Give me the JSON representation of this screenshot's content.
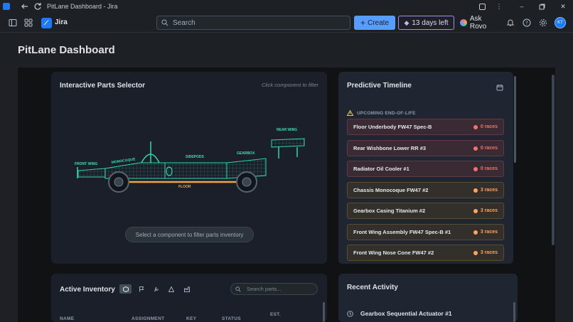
{
  "window": {
    "title": "PitLane Dashboard - Jira"
  },
  "topnav": {
    "product": "Jira",
    "search_placeholder": "Search",
    "create_label": "Create",
    "trial_label": "13 days left",
    "rovo_label": "Ask Rovo",
    "avatar_initials": "KT"
  },
  "page": {
    "title": "PitLane Dashboard"
  },
  "parts_selector": {
    "title": "Interactive Parts Selector",
    "hint": "Click component to filter",
    "labels": {
      "front_wing": "FRONT WING",
      "monocoque": "MONOCOQUE",
      "sidepods": "SIDEPODS",
      "gearbox": "GEARBOX",
      "rear_wing": "REAR WING",
      "floor": "FLOOR"
    },
    "filter_prompt": "Select a component to filter parts inventory"
  },
  "timeline": {
    "title": "Predictive Timeline",
    "section_label": "UPCOMING END-OF-LIFE",
    "items": [
      {
        "name": "Floor Underbody FW47 Spec-B",
        "races": "0 races",
        "status": "red"
      },
      {
        "name": "Rear Wishbone Lower RR #3",
        "races": "0 races",
        "status": "red"
      },
      {
        "name": "Radiator Oil Cooler #1",
        "races": "0 races",
        "status": "red"
      },
      {
        "name": "Chassis Monocoque FW47 #2",
        "races": "3 races",
        "status": "orange"
      },
      {
        "name": "Gearbox Casing Titanium #2",
        "races": "3 races",
        "status": "orange"
      },
      {
        "name": "Front Wing Assembly FW47 Spec-B #1",
        "races": "3 races",
        "status": "orange"
      },
      {
        "name": "Front Wing Nose Cone FW47 #2",
        "races": "3 races",
        "status": "orange"
      }
    ]
  },
  "inventory": {
    "title": "Active Inventory",
    "search_placeholder": "Search parts...",
    "columns": [
      "NAME",
      "ASSIGNMENT",
      "KEY",
      "STATUS",
      "EST."
    ]
  },
  "activity": {
    "title": "Recent Activity",
    "items": [
      {
        "name": "Gearbox Sequential Actuator #1"
      }
    ]
  },
  "colors": {
    "accent": "#579dff",
    "car": "#2fd9a6",
    "labels": "#34e0b0",
    "floor": "#f0a53c",
    "red": "#f87168",
    "orange": "#fea362"
  }
}
